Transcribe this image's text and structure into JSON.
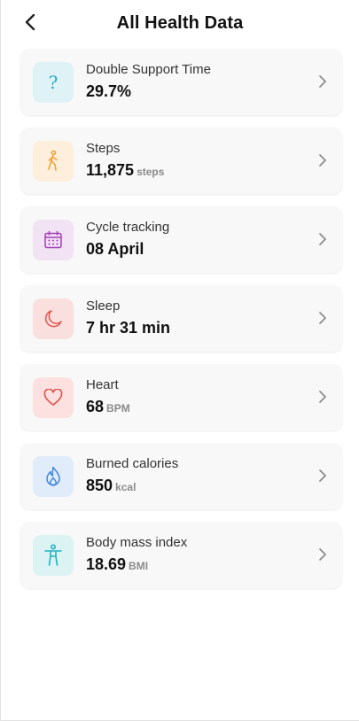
{
  "header": {
    "title": "All Health Data"
  },
  "items": [
    {
      "label": "Double Support Time",
      "value": "29.7%",
      "unit": "",
      "icon": "question-icon",
      "icon_bg": "#dff3f7",
      "icon_color": "#29a9c7"
    },
    {
      "label": "Steps",
      "value": "11,875",
      "unit": "steps",
      "icon": "walking-person-icon",
      "icon_bg": "#fdefdc",
      "icon_color": "#f2a23a"
    },
    {
      "label": "Cycle tracking",
      "value": "08 April",
      "unit": "",
      "icon": "calendar-icon",
      "icon_bg": "#f1e2f4",
      "icon_color": "#a23fb6"
    },
    {
      "label": "Sleep",
      "value": "7 hr 31 min",
      "unit": "",
      "icon": "moon-icon",
      "icon_bg": "#f9e0df",
      "icon_color": "#e0554d"
    },
    {
      "label": "Heart",
      "value": "68",
      "unit": "BPM",
      "icon": "heart-icon",
      "icon_bg": "#fce1e0",
      "icon_color": "#e35047"
    },
    {
      "label": "Burned calories",
      "value": "850",
      "unit": "kcal",
      "icon": "flame-icon",
      "icon_bg": "#e1ecfa",
      "icon_color": "#3f86d8"
    },
    {
      "label": "Body mass index",
      "value": "18.69",
      "unit": "BMI",
      "icon": "body-icon",
      "icon_bg": "#dcf3f4",
      "icon_color": "#22b3c1"
    }
  ]
}
